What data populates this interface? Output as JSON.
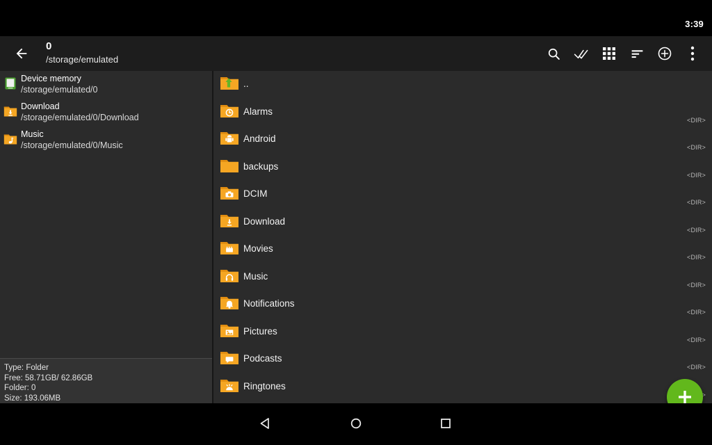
{
  "status_bar": {
    "time": "3:39"
  },
  "app_bar": {
    "back_icon": "arrow-left-icon",
    "title": "0",
    "subtitle": "/storage/emulated",
    "actions": [
      {
        "name": "search-icon",
        "label": "Search"
      },
      {
        "name": "select-all-icon",
        "label": "Select all"
      },
      {
        "name": "grid-view-icon",
        "label": "Grid view"
      },
      {
        "name": "sort-icon",
        "label": "Sort"
      },
      {
        "name": "add-circle-icon",
        "label": "Add"
      },
      {
        "name": "overflow-menu-icon",
        "label": "More options"
      }
    ],
    "resize_handle_icon": "resize-handle-icon"
  },
  "sidebar": {
    "favorites": [
      {
        "icon": "device-memory-icon",
        "name": "Device memory",
        "path": "/storage/emulated/0"
      },
      {
        "icon": "folder-download-icon",
        "name": "Download",
        "path": "/storage/emulated/0/Download"
      },
      {
        "icon": "folder-music-icon",
        "name": "Music",
        "path": "/storage/emulated/0/Music"
      }
    ],
    "info": {
      "type": "Type: Folder",
      "free": "Free: 58.71GB/ 62.86GB",
      "folder": "Folder: 0",
      "size": "Size: 193.06MB"
    }
  },
  "file_list": {
    "dir_label": "<DIR>",
    "items": [
      {
        "name": "..",
        "icon": "folder-up-icon",
        "is_dir": false
      },
      {
        "name": "Alarms",
        "icon": "folder-alarm-icon",
        "is_dir": true
      },
      {
        "name": "Android",
        "icon": "folder-android-icon",
        "is_dir": true
      },
      {
        "name": "backups",
        "icon": "folder-plain-icon",
        "is_dir": true
      },
      {
        "name": "DCIM",
        "icon": "folder-camera-icon",
        "is_dir": true
      },
      {
        "name": "Download",
        "icon": "folder-download-icon",
        "is_dir": true
      },
      {
        "name": "Movies",
        "icon": "folder-movies-icon",
        "is_dir": true
      },
      {
        "name": "Music",
        "icon": "folder-music-icon",
        "is_dir": true
      },
      {
        "name": "Notifications",
        "icon": "folder-notification-icon",
        "is_dir": true
      },
      {
        "name": "Pictures",
        "icon": "folder-pictures-icon",
        "is_dir": true
      },
      {
        "name": "Podcasts",
        "icon": "folder-podcasts-icon",
        "is_dir": true
      },
      {
        "name": "Ringtones",
        "icon": "folder-ringtones-icon",
        "is_dir": true
      }
    ]
  },
  "fab": {
    "icon": "plus-icon",
    "label": "Add"
  },
  "nav_bar": {
    "back": "nav-back-icon",
    "home": "nav-home-icon",
    "recents": "nav-recents-icon"
  },
  "colors": {
    "folder": "#f5a623",
    "folder_dark": "#e08c10",
    "accent_green": "#62b81c",
    "app_bar": "#1d1d1d",
    "panel": "#2b2b2b",
    "info_panel": "#333333"
  }
}
